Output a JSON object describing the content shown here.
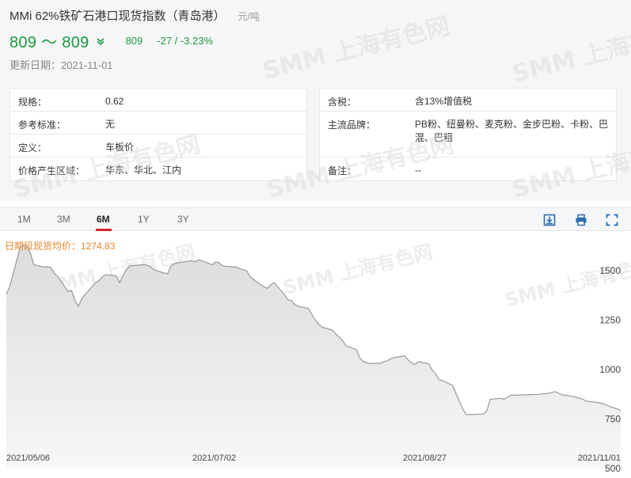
{
  "header": {
    "title": "MMi 62%铁矿石港口现货指数（青岛港）",
    "unit": "元/吨",
    "price_range": "809 ～ 809",
    "avg_price": "809",
    "change": "-27  /  -3.23%",
    "update_date": "更新日期：2021-11-01"
  },
  "info_left": [
    {
      "key": "规格：",
      "value": "0.62"
    },
    {
      "key": "参考标准：",
      "value": "无"
    },
    {
      "key": "定义：",
      "value": "车板价"
    },
    {
      "key": "价格产生区域：",
      "value": "华东、华北、江内"
    }
  ],
  "info_right": [
    {
      "key": "含税：",
      "value": "含13%增值税"
    },
    {
      "key": "主流品牌：",
      "value": "PB粉、纽曼粉、麦克粉、金步巴粉、卡粉、巴混、巴粗"
    },
    {
      "key": "备注：",
      "value": "--"
    }
  ],
  "watermark": "SMM 上海有色网",
  "tabs": [
    {
      "label": "1M",
      "active": false
    },
    {
      "label": "3M",
      "active": false
    },
    {
      "label": "6M",
      "active": true
    },
    {
      "label": "1Y",
      "active": false
    },
    {
      "label": "3Y",
      "active": false
    }
  ],
  "colors": {
    "green": "#1a9a3e",
    "accent": "#d7262b",
    "avg_label": "#e8862a",
    "line": "#9a9a9a"
  },
  "chart_data": {
    "type": "area",
    "avg_label": "日期段现货均价：1274.83",
    "x_ticks": [
      "2021/05/06",
      "2021/07/02",
      "2021/08/27",
      "2021/11/01"
    ],
    "y_ticks": [
      1500,
      1250,
      1000,
      750,
      500
    ],
    "ylim": [
      500,
      1660
    ],
    "grid": false,
    "x_start": "2021-05-06",
    "x_end": "2021-11-01",
    "series": [
      {
        "x": [
          "2021-05-06",
          "2021-05-07",
          "2021-05-10",
          "2021-05-11",
          "2021-05-12",
          "2021-05-13",
          "2021-05-14",
          "2021-05-17",
          "2021-05-18",
          "2021-05-19",
          "2021-05-20",
          "2021-05-21",
          "2021-05-24",
          "2021-05-25",
          "2021-05-26",
          "2021-05-27",
          "2021-05-28",
          "2021-05-31",
          "2021-06-01",
          "2021-06-02",
          "2021-06-03",
          "2021-06-04",
          "2021-06-07",
          "2021-06-08",
          "2021-06-09",
          "2021-06-10",
          "2021-06-11",
          "2021-06-15",
          "2021-06-16",
          "2021-06-17",
          "2021-06-18",
          "2021-06-21",
          "2021-06-22",
          "2021-06-23",
          "2021-06-24",
          "2021-06-25",
          "2021-06-28",
          "2021-06-29",
          "2021-06-30",
          "2021-07-01",
          "2021-07-02",
          "2021-07-05",
          "2021-07-06",
          "2021-07-07",
          "2021-07-08",
          "2021-07-09",
          "2021-07-12",
          "2021-07-13",
          "2021-07-14",
          "2021-07-15",
          "2021-07-16",
          "2021-07-19",
          "2021-07-20",
          "2021-07-21",
          "2021-07-22",
          "2021-07-23",
          "2021-07-26",
          "2021-07-27",
          "2021-07-28",
          "2021-07-29",
          "2021-07-30",
          "2021-08-02",
          "2021-08-03",
          "2021-08-04",
          "2021-08-05",
          "2021-08-06",
          "2021-08-09",
          "2021-08-10",
          "2021-08-11",
          "2021-08-12",
          "2021-08-13",
          "2021-08-16",
          "2021-08-17",
          "2021-08-18",
          "2021-08-19",
          "2021-08-20",
          "2021-08-23",
          "2021-08-24",
          "2021-08-25",
          "2021-08-26",
          "2021-08-27",
          "2021-08-30",
          "2021-08-31",
          "2021-09-01",
          "2021-09-02",
          "2021-09-03",
          "2021-09-06",
          "2021-09-07",
          "2021-09-08",
          "2021-09-09",
          "2021-09-10",
          "2021-09-13",
          "2021-09-14",
          "2021-09-15",
          "2021-09-16",
          "2021-09-17",
          "2021-09-22",
          "2021-09-23",
          "2021-09-24",
          "2021-09-27",
          "2021-09-28",
          "2021-09-29",
          "2021-09-30",
          "2021-10-08",
          "2021-10-11",
          "2021-10-12",
          "2021-10-13",
          "2021-10-14",
          "2021-10-15",
          "2021-10-18",
          "2021-10-19",
          "2021-10-20",
          "2021-10-21",
          "2021-10-22",
          "2021-10-25",
          "2021-10-26",
          "2021-10-27",
          "2021-10-28",
          "2021-10-29",
          "2021-11-01"
        ],
        "y": [
          1380,
          1420,
          1615,
          1630,
          1625,
          1590,
          1530,
          1518,
          1520,
          1515,
          1488,
          1470,
          1395,
          1400,
          1350,
          1320,
          1360,
          1420,
          1440,
          1450,
          1470,
          1480,
          1474,
          1440,
          1475,
          1505,
          1525,
          1530,
          1528,
          1520,
          1505,
          1488,
          1485,
          1525,
          1535,
          1540,
          1548,
          1550,
          1545,
          1555,
          1550,
          1530,
          1545,
          1540,
          1525,
          1522,
          1518,
          1510,
          1505,
          1500,
          1470,
          1430,
          1420,
          1410,
          1428,
          1440,
          1380,
          1352,
          1350,
          1330,
          1320,
          1310,
          1280,
          1250,
          1230,
          1215,
          1200,
          1180,
          1165,
          1145,
          1120,
          1100,
          1060,
          1040,
          1035,
          1030,
          1032,
          1040,
          1045,
          1055,
          1060,
          1070,
          1050,
          1035,
          1025,
          1040,
          1030,
          1000,
          980,
          950,
          945,
          920,
          880,
          840,
          800,
          772,
          775,
          790,
          850,
          855,
          850,
          860,
          870,
          875,
          880,
          885,
          888,
          880,
          872,
          865,
          860,
          855,
          850,
          840,
          835,
          830,
          828,
          820,
          812,
          795
        ]
      }
    ]
  }
}
